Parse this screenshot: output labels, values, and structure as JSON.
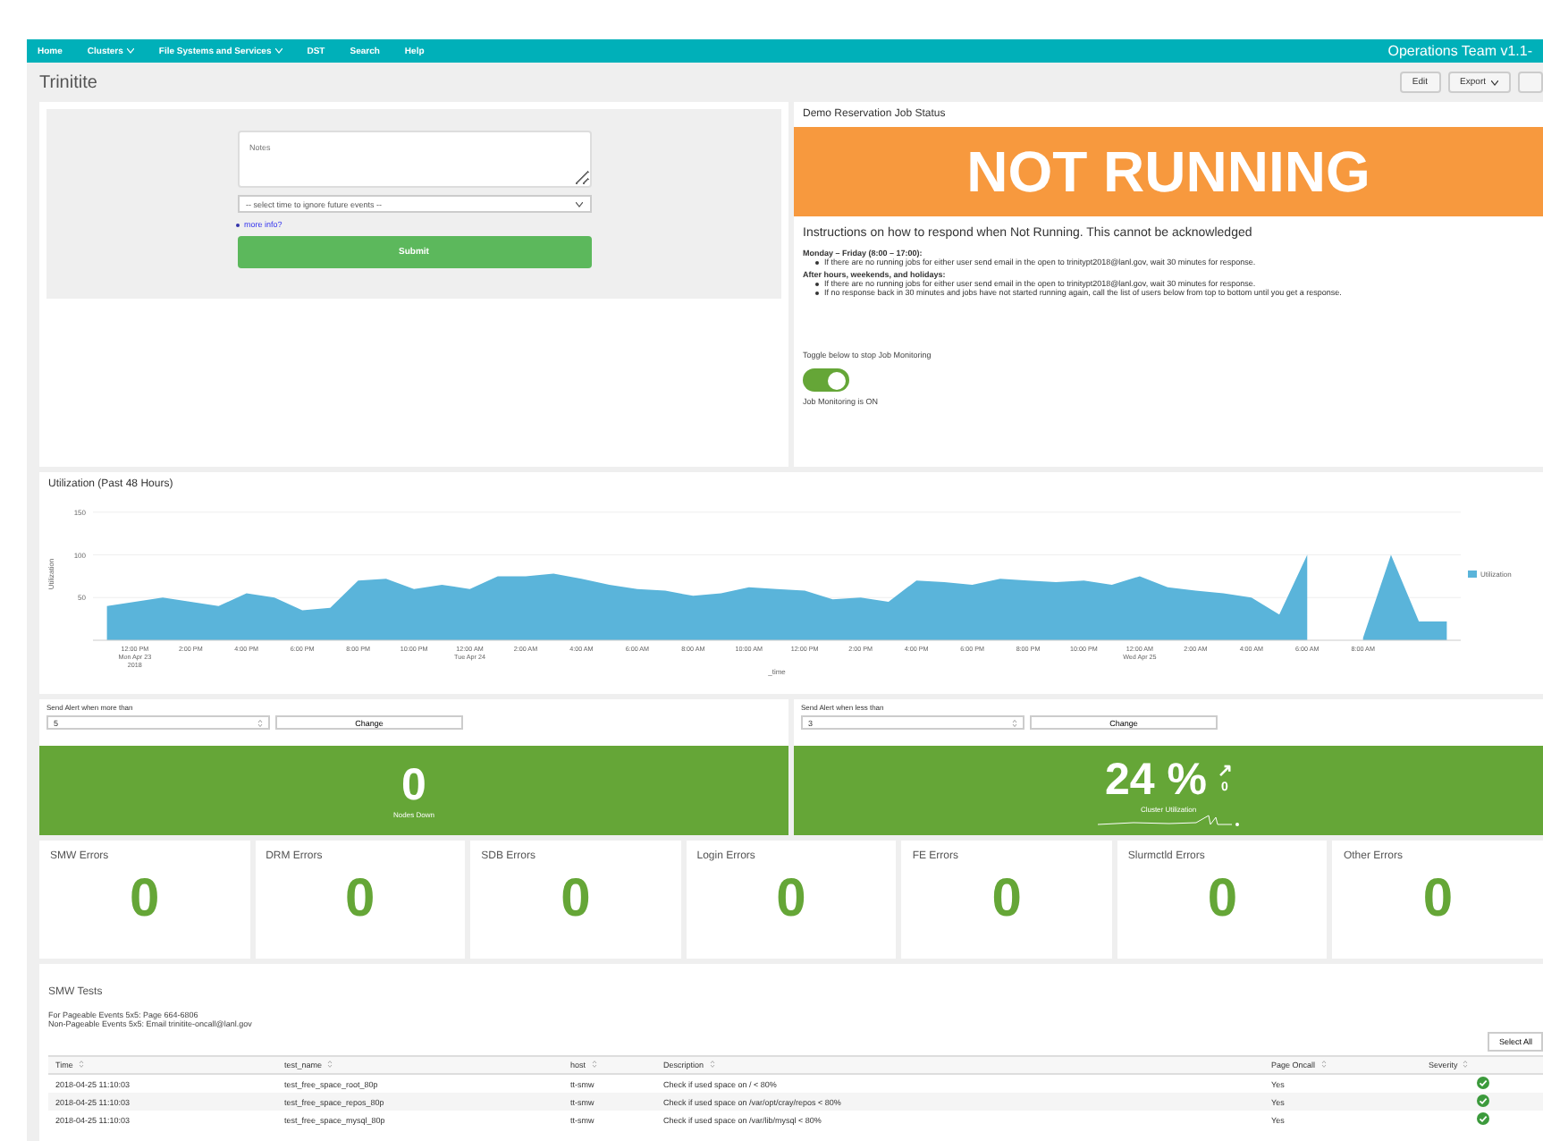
{
  "nav": {
    "items": [
      {
        "label": "Home",
        "dropdown": false
      },
      {
        "label": "Clusters",
        "dropdown": true
      },
      {
        "label": "File Systems and Services",
        "dropdown": true
      },
      {
        "label": "DST",
        "dropdown": false
      },
      {
        "label": "Search",
        "dropdown": false
      },
      {
        "label": "Help",
        "dropdown": false
      }
    ],
    "app_title": "Operations Team v1.1-"
  },
  "dashboard": {
    "title": "Trinitite",
    "buttons": [
      {
        "label": "Edit",
        "dropdown": false
      },
      {
        "label": "Export",
        "dropdown": true
      }
    ]
  },
  "form": {
    "notes": {
      "placeholder": "Notes"
    },
    "select": {
      "value": "-- select time to ignore future events --"
    },
    "link": "more info?",
    "submit": "Submit"
  },
  "status": {
    "title": "Demo Reservation Job Status",
    "banner": "NOT RUNNING",
    "heading": "Instructions on how to respond when Not Running. This cannot be acknowledged",
    "sections": [
      {
        "title": "Monday – Friday (8:00 – 17:00):",
        "items": [
          "If there are no running jobs for either user send email in the open to trinitypt2018@lanl.gov, wait 30 minutes for response."
        ]
      },
      {
        "title": "After hours, weekends, and holidays:",
        "items": [
          "If there are no running jobs for either user send email in the open to trinitypt2018@lanl.gov, wait 30 minutes for response.",
          "If no response back in 30 minutes and jobs have not started running again, call the list of users below from top to bottom until you get a response."
        ]
      }
    ],
    "toggle_label": "Toggle below to stop Job Monitoring",
    "toggle": {
      "on": true
    },
    "toggle_status": "Job Monitoring is ON"
  },
  "utilization": {
    "title": "Utilization (Past 48 Hours)",
    "chart_data": {
      "type": "area",
      "xlabel": "_time",
      "ylabel": "Utilization",
      "categories": [
        null,
        "12:00 PM\nMon Apr 23\n2018",
        null,
        "2:00 PM",
        null,
        "4:00 PM",
        null,
        "6:00 PM",
        null,
        "8:00 PM",
        null,
        "10:00 PM",
        null,
        "12:00 AM\nTue Apr 24",
        null,
        "2:00 AM",
        null,
        "4:00 AM",
        null,
        "6:00 AM",
        null,
        "8:00 AM",
        null,
        "10:00 AM",
        null,
        "12:00 PM",
        null,
        "2:00 PM",
        null,
        "4:00 PM",
        null,
        "6:00 PM",
        null,
        "8:00 PM",
        null,
        "10:00 PM",
        null,
        "12:00 AM\nWed Apr 25",
        null,
        "2:00 AM",
        null,
        "4:00 AM",
        null,
        "6:00 AM",
        null,
        "8:00 AM",
        null,
        null,
        null
      ],
      "series": [
        {
          "name": "Utilization",
          "color": "#5ab4da",
          "values": [
            40,
            45,
            50,
            45,
            40,
            55,
            50,
            35,
            38,
            70,
            72,
            60,
            65,
            60,
            75,
            75,
            78,
            72,
            65,
            60,
            58,
            52,
            55,
            62,
            60,
            58,
            48,
            50,
            45,
            70,
            68,
            65,
            72,
            70,
            68,
            70,
            65,
            75,
            62,
            58,
            55,
            50,
            30,
            100,
            null,
            3,
            100,
            22,
            22
          ]
        }
      ],
      "ylim": [
        0,
        155
      ],
      "yticks": [
        50,
        100,
        150
      ]
    }
  },
  "alerts": [
    {
      "label": "Send Alert when more than",
      "value": "5",
      "button": "Change",
      "metric": "0",
      "metric_label": "Nodes Down"
    },
    {
      "label": "Send Alert when less than",
      "value": "3",
      "button": "Change",
      "metric": "24 %",
      "trend_arrow": "↗",
      "trend_value": "0",
      "metric_label": "Cluster Utilization"
    }
  ],
  "errors": [
    {
      "title": "SMW Errors",
      "value": "0"
    },
    {
      "title": "DRM Errors",
      "value": "0"
    },
    {
      "title": "SDB Errors",
      "value": "0"
    },
    {
      "title": "Login Errors",
      "value": "0"
    },
    {
      "title": "FE Errors",
      "value": "0"
    },
    {
      "title": "Slurmctld Errors",
      "value": "0"
    },
    {
      "title": "Other Errors",
      "value": "0"
    }
  ],
  "smw_tests": {
    "title": "SMW Tests",
    "notes": [
      "For Pageable Events 5x5: Page 664-6806",
      "Non-Pageable Events 5x5: Email trinitite-oncall@lanl.gov"
    ],
    "select_all": "Select All",
    "columns": [
      "Time",
      "test_name",
      "host",
      "Description",
      "Page Oncall",
      "Severity"
    ],
    "rows": [
      {
        "time": "2018-04-25 11:10:03",
        "test_name": "test_free_space_root_80p",
        "host": "tt-smw",
        "description": "Check if used space on / < 80%",
        "page_oncall": "Yes",
        "passed": true
      },
      {
        "time": "2018-04-25 11:10:03",
        "test_name": "test_free_space_repos_80p",
        "host": "tt-smw",
        "description": "Check if used space on /var/opt/cray/repos < 80%",
        "page_oncall": "Yes",
        "passed": true
      },
      {
        "time": "2018-04-25 11:10:03",
        "test_name": "test_free_space_mysql_80p",
        "host": "tt-smw",
        "description": "Check if used space on /var/lib/mysql < 80%",
        "page_oncall": "Yes",
        "passed": true
      }
    ]
  }
}
